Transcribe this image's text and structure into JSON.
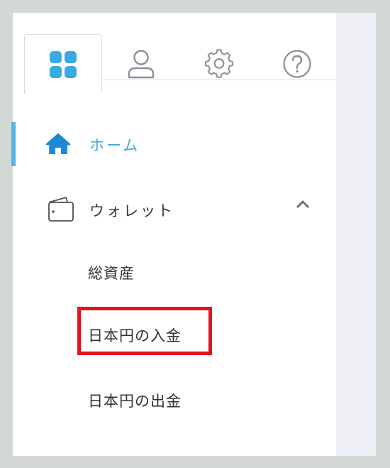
{
  "tabs": [
    {
      "icon": "grid-icon",
      "active": true
    },
    {
      "icon": "user-icon",
      "active": false
    },
    {
      "icon": "gear-icon",
      "active": false
    },
    {
      "icon": "help-icon",
      "active": false
    }
  ],
  "nav": {
    "home_label": "ホーム",
    "wallet_label": "ウォレット",
    "wallet_sub_items": [
      "総資産",
      "日本円の入金",
      "日本円の出金"
    ]
  },
  "colors": {
    "accent": "#3aaae0",
    "highlight": "#e0141a",
    "text": "#333a40",
    "icon_gray": "#8a9098"
  }
}
